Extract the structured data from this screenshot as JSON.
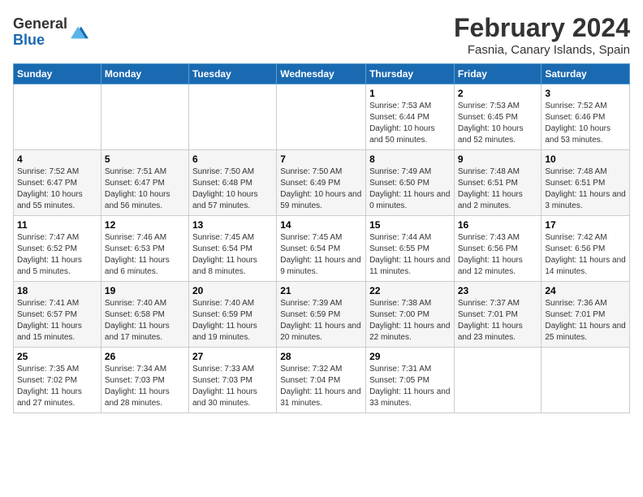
{
  "header": {
    "logo_general": "General",
    "logo_blue": "Blue",
    "main_title": "February 2024",
    "subtitle": "Fasnia, Canary Islands, Spain"
  },
  "days_of_week": [
    "Sunday",
    "Monday",
    "Tuesday",
    "Wednesday",
    "Thursday",
    "Friday",
    "Saturday"
  ],
  "weeks": [
    [
      {
        "day": "",
        "info": ""
      },
      {
        "day": "",
        "info": ""
      },
      {
        "day": "",
        "info": ""
      },
      {
        "day": "",
        "info": ""
      },
      {
        "day": "1",
        "info": "Sunrise: 7:53 AM\nSunset: 6:44 PM\nDaylight: 10 hours and 50 minutes."
      },
      {
        "day": "2",
        "info": "Sunrise: 7:53 AM\nSunset: 6:45 PM\nDaylight: 10 hours and 52 minutes."
      },
      {
        "day": "3",
        "info": "Sunrise: 7:52 AM\nSunset: 6:46 PM\nDaylight: 10 hours and 53 minutes."
      }
    ],
    [
      {
        "day": "4",
        "info": "Sunrise: 7:52 AM\nSunset: 6:47 PM\nDaylight: 10 hours and 55 minutes."
      },
      {
        "day": "5",
        "info": "Sunrise: 7:51 AM\nSunset: 6:47 PM\nDaylight: 10 hours and 56 minutes."
      },
      {
        "day": "6",
        "info": "Sunrise: 7:50 AM\nSunset: 6:48 PM\nDaylight: 10 hours and 57 minutes."
      },
      {
        "day": "7",
        "info": "Sunrise: 7:50 AM\nSunset: 6:49 PM\nDaylight: 10 hours and 59 minutes."
      },
      {
        "day": "8",
        "info": "Sunrise: 7:49 AM\nSunset: 6:50 PM\nDaylight: 11 hours and 0 minutes."
      },
      {
        "day": "9",
        "info": "Sunrise: 7:48 AM\nSunset: 6:51 PM\nDaylight: 11 hours and 2 minutes."
      },
      {
        "day": "10",
        "info": "Sunrise: 7:48 AM\nSunset: 6:51 PM\nDaylight: 11 hours and 3 minutes."
      }
    ],
    [
      {
        "day": "11",
        "info": "Sunrise: 7:47 AM\nSunset: 6:52 PM\nDaylight: 11 hours and 5 minutes."
      },
      {
        "day": "12",
        "info": "Sunrise: 7:46 AM\nSunset: 6:53 PM\nDaylight: 11 hours and 6 minutes."
      },
      {
        "day": "13",
        "info": "Sunrise: 7:45 AM\nSunset: 6:54 PM\nDaylight: 11 hours and 8 minutes."
      },
      {
        "day": "14",
        "info": "Sunrise: 7:45 AM\nSunset: 6:54 PM\nDaylight: 11 hours and 9 minutes."
      },
      {
        "day": "15",
        "info": "Sunrise: 7:44 AM\nSunset: 6:55 PM\nDaylight: 11 hours and 11 minutes."
      },
      {
        "day": "16",
        "info": "Sunrise: 7:43 AM\nSunset: 6:56 PM\nDaylight: 11 hours and 12 minutes."
      },
      {
        "day": "17",
        "info": "Sunrise: 7:42 AM\nSunset: 6:56 PM\nDaylight: 11 hours and 14 minutes."
      }
    ],
    [
      {
        "day": "18",
        "info": "Sunrise: 7:41 AM\nSunset: 6:57 PM\nDaylight: 11 hours and 15 minutes."
      },
      {
        "day": "19",
        "info": "Sunrise: 7:40 AM\nSunset: 6:58 PM\nDaylight: 11 hours and 17 minutes."
      },
      {
        "day": "20",
        "info": "Sunrise: 7:40 AM\nSunset: 6:59 PM\nDaylight: 11 hours and 19 minutes."
      },
      {
        "day": "21",
        "info": "Sunrise: 7:39 AM\nSunset: 6:59 PM\nDaylight: 11 hours and 20 minutes."
      },
      {
        "day": "22",
        "info": "Sunrise: 7:38 AM\nSunset: 7:00 PM\nDaylight: 11 hours and 22 minutes."
      },
      {
        "day": "23",
        "info": "Sunrise: 7:37 AM\nSunset: 7:01 PM\nDaylight: 11 hours and 23 minutes."
      },
      {
        "day": "24",
        "info": "Sunrise: 7:36 AM\nSunset: 7:01 PM\nDaylight: 11 hours and 25 minutes."
      }
    ],
    [
      {
        "day": "25",
        "info": "Sunrise: 7:35 AM\nSunset: 7:02 PM\nDaylight: 11 hours and 27 minutes."
      },
      {
        "day": "26",
        "info": "Sunrise: 7:34 AM\nSunset: 7:03 PM\nDaylight: 11 hours and 28 minutes."
      },
      {
        "day": "27",
        "info": "Sunrise: 7:33 AM\nSunset: 7:03 PM\nDaylight: 11 hours and 30 minutes."
      },
      {
        "day": "28",
        "info": "Sunrise: 7:32 AM\nSunset: 7:04 PM\nDaylight: 11 hours and 31 minutes."
      },
      {
        "day": "29",
        "info": "Sunrise: 7:31 AM\nSunset: 7:05 PM\nDaylight: 11 hours and 33 minutes."
      },
      {
        "day": "",
        "info": ""
      },
      {
        "day": "",
        "info": ""
      }
    ]
  ]
}
